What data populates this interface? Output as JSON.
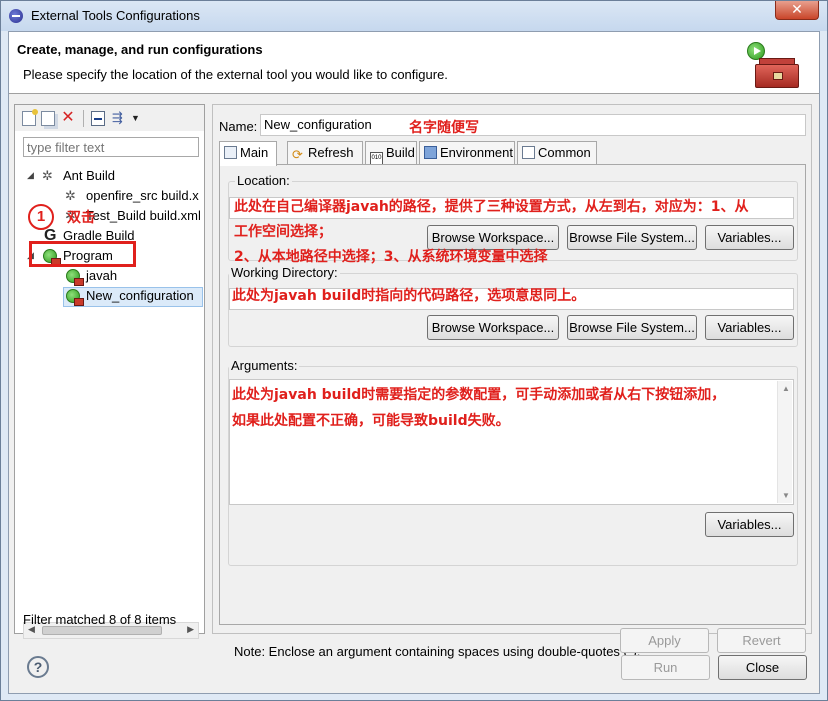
{
  "window": {
    "title": "External Tools Configurations",
    "close_glyph": "✕"
  },
  "header": {
    "title": "Create, manage, and run configurations",
    "description": "Please specify the location of the external tool you would like to configure."
  },
  "left": {
    "filter_placeholder": "type filter text",
    "tree": {
      "ant_build": "Ant Build",
      "openfire_src": "openfire_src build.x",
      "test_build": "Test_Build build.xml",
      "gradle_build": "Gradle Build",
      "program": "Program",
      "javah": "javah",
      "new_configuration": "New_configuration"
    },
    "status": "Filter matched 8 of 8 items"
  },
  "right": {
    "name_label": "Name:",
    "name_value": "New_configuration",
    "tabs": [
      {
        "label": "Main",
        "icon": "main-tab-icon"
      },
      {
        "label": "Refresh",
        "icon": "refresh-icon"
      },
      {
        "label": "Build",
        "icon": "build-icon"
      },
      {
        "label": "Environment",
        "icon": "environment-icon"
      },
      {
        "label": "Common",
        "icon": "common-icon"
      }
    ],
    "location_label": "Location:",
    "working_dir_label": "Working Directory:",
    "arguments_label": "Arguments:",
    "browse_workspace": "Browse Workspace...",
    "browse_file_system": "Browse File System...",
    "variables": "Variables...",
    "note": "Note: Enclose an argument containing spaces using double-quotes (\").",
    "apply": "Apply",
    "revert": "Revert"
  },
  "footer": {
    "run": "Run",
    "close": "Close",
    "help": "?"
  },
  "annotations": {
    "name_hint": "名字随便写",
    "location_line1": "此处在自己编译器javah的路径，提供了三种设置方式，从左到右，对应为：1、从",
    "location_line2": "工作空间选择；",
    "location_line3": "2、从本地路径中选择；3、从系统环境变量中选择",
    "working_dir_hint": "此处为javah build时指向的代码路径，选项意思同上。",
    "arguments_line1": "此处为javah build时需要指定的参数配置，可手动添加或者从右下按钮添加，",
    "arguments_line2": "如果此处配置不正确，可能导致build失败。",
    "step_number": "1",
    "double_click": "双击"
  },
  "colors": {
    "annotation_red": "#e0201c",
    "selection_blue": "#dbeaf9"
  }
}
